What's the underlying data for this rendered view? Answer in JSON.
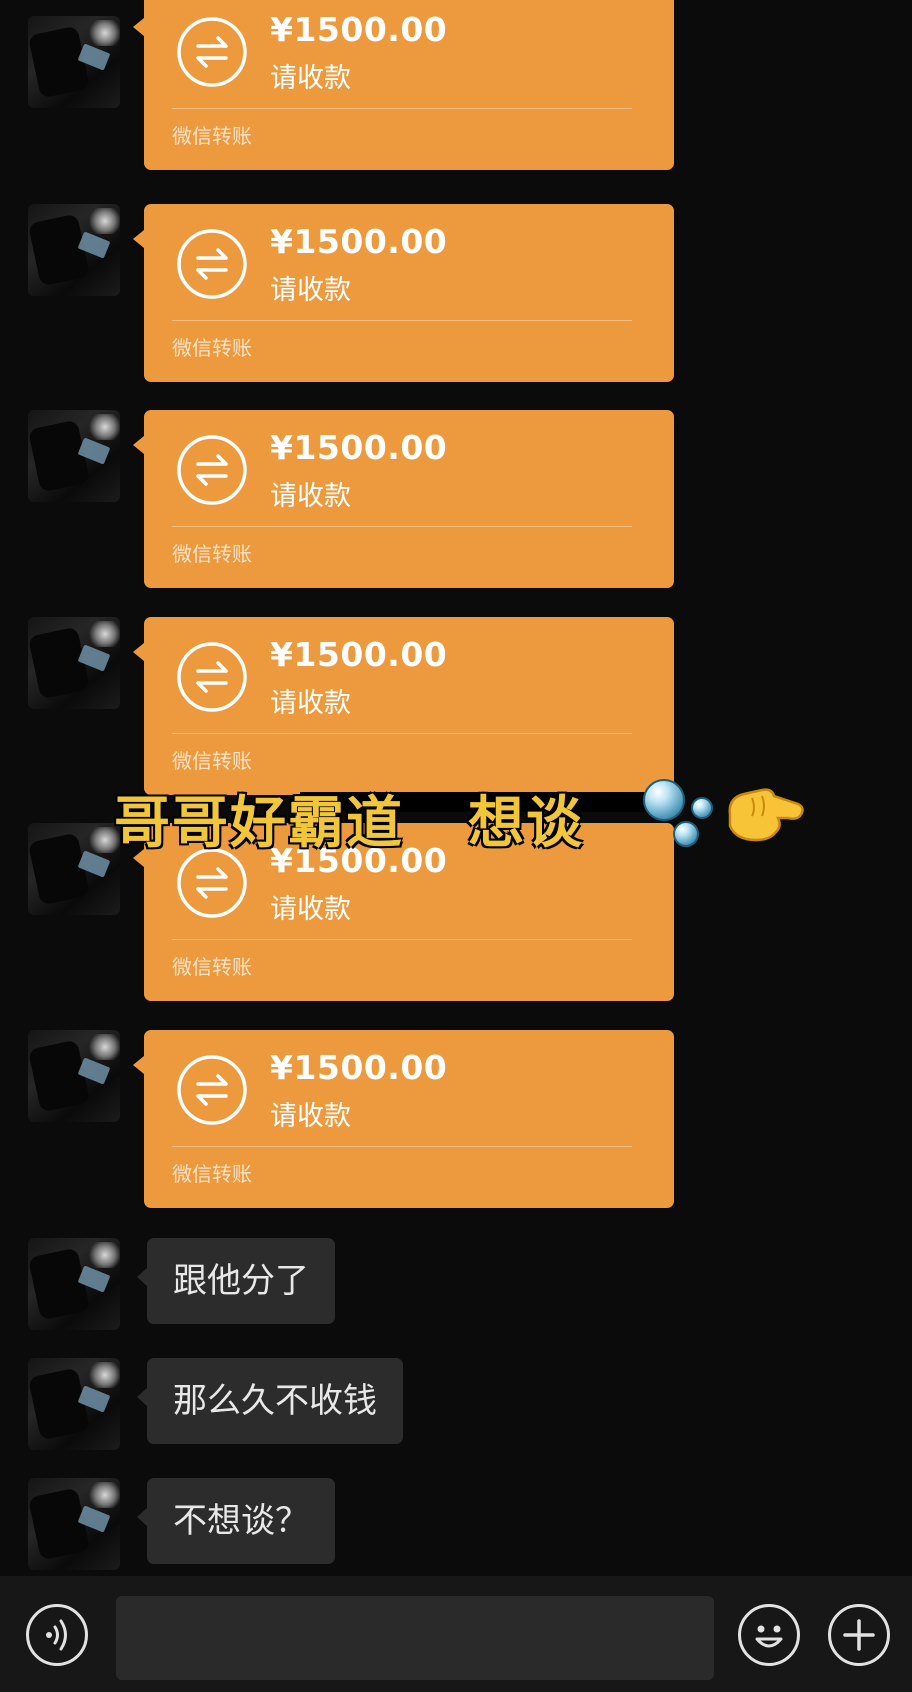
{
  "chat": {
    "transfers": [
      {
        "amount": "¥1500.00",
        "status": "请收款",
        "footer": "微信转账"
      },
      {
        "amount": "¥1500.00",
        "status": "请收款",
        "footer": "微信转账"
      },
      {
        "amount": "¥1500.00",
        "status": "请收款",
        "footer": "微信转账"
      },
      {
        "amount": "¥1500.00",
        "status": "请收款",
        "footer": "微信转账"
      },
      {
        "amount": "¥1500.00",
        "status": "请收款",
        "footer": "微信转账"
      },
      {
        "amount": "¥1500.00",
        "status": "请收款",
        "footer": "微信转账"
      }
    ],
    "texts": [
      {
        "text": "跟他分了"
      },
      {
        "text": "那么久不收钱"
      },
      {
        "text": "不想谈？"
      }
    ]
  },
  "overlay": {
    "part1": "哥哥好霸道",
    "part2": "想谈",
    "emojis": [
      "bubbles-icon",
      "pointing-hand-icon"
    ]
  },
  "input_bar": {
    "voice_icon": "voice-icon",
    "input_value": "",
    "emoji_icon": "smiley-icon",
    "plus_icon": "plus-icon"
  },
  "colors": {
    "background": "#0b0b0b",
    "transfer_bubble": "#ec9a3d",
    "text_bubble": "#2c2c2c",
    "caption": "#f2c63a"
  }
}
